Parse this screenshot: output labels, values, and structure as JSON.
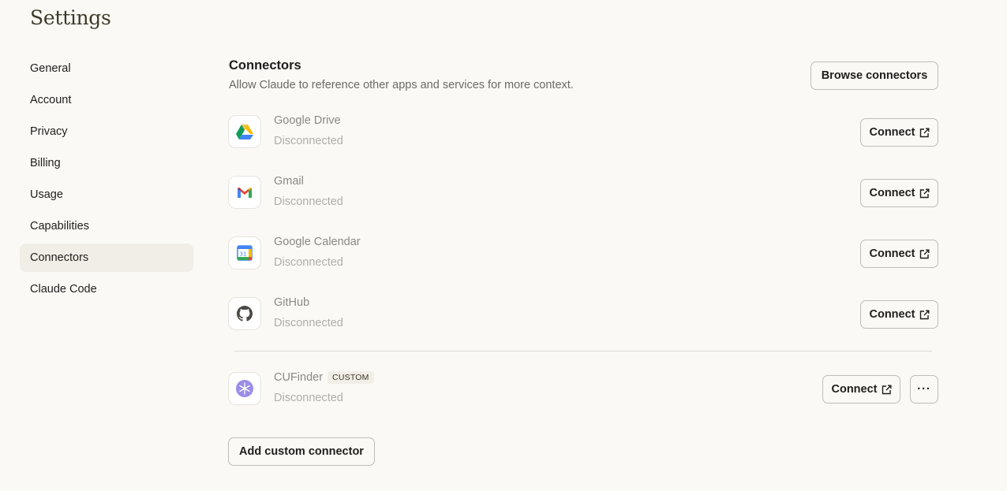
{
  "page": {
    "title": "Settings"
  },
  "sidebar": {
    "items": [
      {
        "label": "General",
        "active": false
      },
      {
        "label": "Account",
        "active": false
      },
      {
        "label": "Privacy",
        "active": false
      },
      {
        "label": "Billing",
        "active": false
      },
      {
        "label": "Usage",
        "active": false
      },
      {
        "label": "Capabilities",
        "active": false
      },
      {
        "label": "Connectors",
        "active": true
      },
      {
        "label": "Claude Code",
        "active": false
      }
    ]
  },
  "connectors": {
    "title": "Connectors",
    "description": "Allow Claude to reference other apps and services for more context.",
    "browse_label": "Browse connectors",
    "connect_label": "Connect",
    "more_label": "···",
    "add_custom_label": "Add custom connector",
    "items": [
      {
        "name": "Google Drive",
        "status": "Disconnected",
        "icon": "google-drive-icon"
      },
      {
        "name": "Gmail",
        "status": "Disconnected",
        "icon": "gmail-icon"
      },
      {
        "name": "Google Calendar",
        "status": "Disconnected",
        "icon": "google-calendar-icon",
        "icon_text": "31"
      },
      {
        "name": "GitHub",
        "status": "Disconnected",
        "icon": "github-icon"
      }
    ],
    "custom": {
      "name": "CUFinder",
      "badge": "CUSTOM",
      "status": "Disconnected",
      "icon": "cufinder-icon"
    }
  },
  "colors": {
    "background": "#faf9f5",
    "active_nav": "#f0eee6",
    "status_text": "#b0aea7"
  }
}
